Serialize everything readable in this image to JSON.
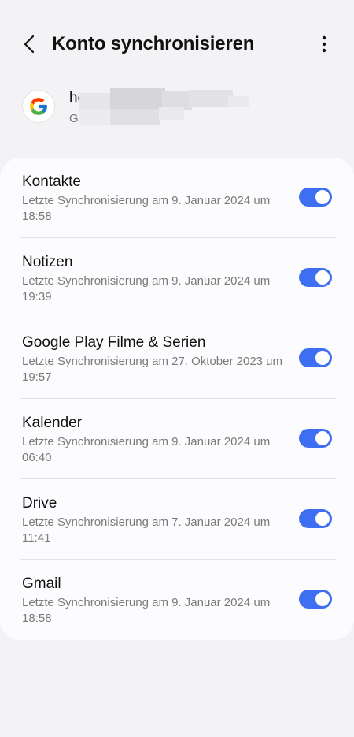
{
  "header": {
    "title": "Konto synchronisieren",
    "back_icon": "chevron-left-icon",
    "more_icon": "more-vertical-icon"
  },
  "account": {
    "name": "ho",
    "sub": "G"
  },
  "colors": {
    "toggle_on": "#3e6ff2",
    "background": "#f3f3f6",
    "card": "#fcfcfe"
  },
  "sync_items": [
    {
      "title": "Kontakte",
      "subtitle": "Letzte Synchronisierung am 9. Januar 2024 um 18:58",
      "enabled": true
    },
    {
      "title": "Notizen",
      "subtitle": "Letzte Synchronisierung am 9. Januar 2024 um 19:39",
      "enabled": true
    },
    {
      "title": "Google Play Filme & Serien",
      "subtitle": "Letzte Synchronisierung am 27. Oktober 2023 um 19:57",
      "enabled": true
    },
    {
      "title": "Kalender",
      "subtitle": "Letzte Synchronisierung am 9. Januar 2024 um 06:40",
      "enabled": true
    },
    {
      "title": "Drive",
      "subtitle": "Letzte Synchronisierung am 7. Januar 2024 um 11:41",
      "enabled": true
    },
    {
      "title": "Gmail",
      "subtitle": "Letzte Synchronisierung am 9. Januar 2024 um 18:58",
      "enabled": true
    }
  ]
}
